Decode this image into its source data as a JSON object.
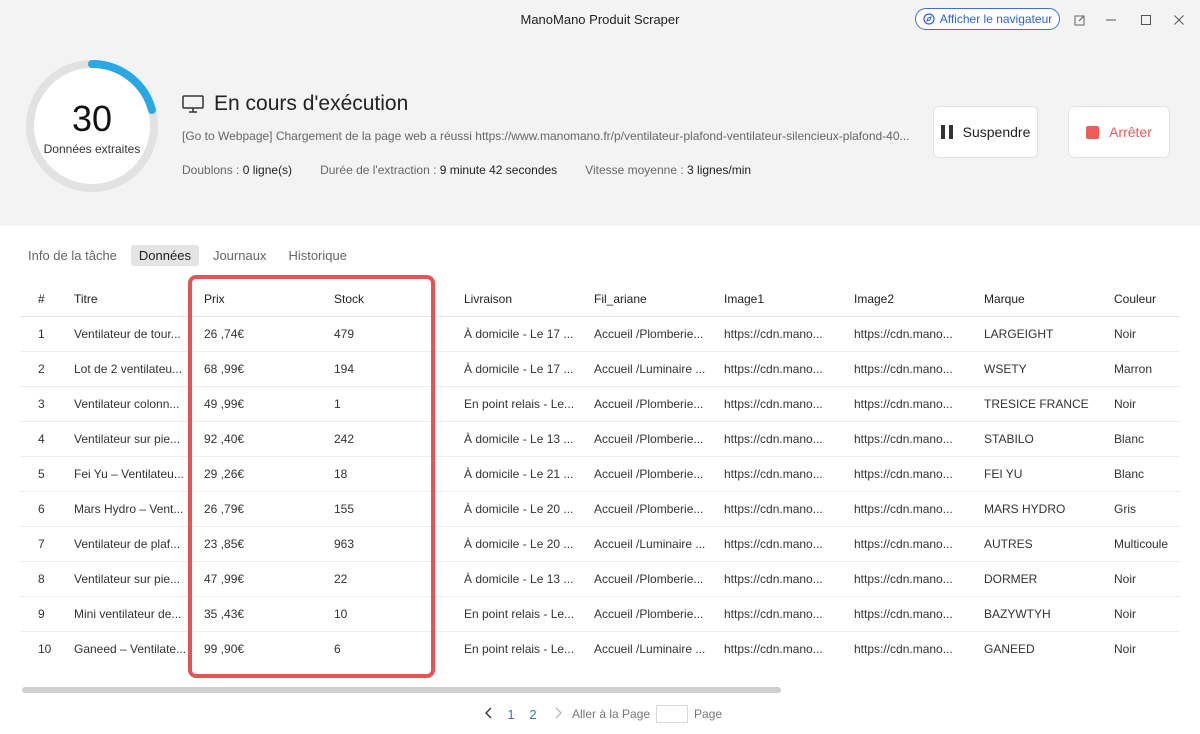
{
  "app": {
    "title": "ManoMano Produit Scraper",
    "browser_button": "Afficher le navigateur"
  },
  "progress": {
    "count": "30",
    "label": "Données extraites"
  },
  "status": {
    "title": "En cours d'exécution",
    "message": "[Go to Webpage] Chargement de la page web a réussi https://www.manomano.fr/p/ventilateur-plafond-ventilateur-silencieux-plafond-40...",
    "duplicates_label": "Doublons : ",
    "duplicates_value": "0 ligne(s)",
    "duration_label": "Durée de l'extraction : ",
    "duration_value": "9 minute 42 secondes",
    "speed_label": "Vitesse moyenne : ",
    "speed_value": "3 lignes/min"
  },
  "actions": {
    "pause": "Suspendre",
    "stop": "Arrêter"
  },
  "tabs": [
    {
      "label": "Info de la tâche"
    },
    {
      "label": "Données",
      "active": true
    },
    {
      "label": "Journaux"
    },
    {
      "label": "Historique"
    }
  ],
  "table": {
    "headers": [
      "#",
      "Titre",
      "Prix",
      "Stock",
      "Livraison",
      "Fil_ariane",
      "Image1",
      "Image2",
      "Marque",
      "Couleur"
    ],
    "rows": [
      [
        "1",
        "Ventilateur de tour...",
        "26 ,74€",
        "479",
        "À domicile - Le 17 ...",
        "Accueil /Plomberie...",
        "https://cdn.mano...",
        "https://cdn.mano...",
        "LARGEIGHT",
        "Noir"
      ],
      [
        "2",
        "Lot de 2 ventilateu...",
        "68 ,99€",
        "194",
        "À domicile - Le 17 ...",
        "Accueil /Luminaire ...",
        "https://cdn.mano...",
        "https://cdn.mano...",
        "WSETY",
        "Marron"
      ],
      [
        "3",
        "Ventilateur colonn...",
        "49 ,99€",
        "1",
        "En point relais - Le...",
        "Accueil /Plomberie...",
        "https://cdn.mano...",
        "https://cdn.mano...",
        "TRESICE FRANCE",
        "Noir"
      ],
      [
        "4",
        "Ventilateur sur pie...",
        "92 ,40€",
        "242",
        "À domicile - Le 13 ...",
        "Accueil /Plomberie...",
        "https://cdn.mano...",
        "https://cdn.mano...",
        "STABILO",
        "Blanc"
      ],
      [
        "5",
        "Fei Yu – Ventilateu...",
        "29 ,26€",
        "18",
        "À domicile - Le 21 ...",
        "Accueil /Plomberie...",
        "https://cdn.mano...",
        "https://cdn.mano...",
        "FEI YU",
        "Blanc"
      ],
      [
        "6",
        "Mars Hydro – Vent...",
        "26 ,79€",
        "155",
        "À domicile - Le 20 ...",
        "Accueil /Plomberie...",
        "https://cdn.mano...",
        "https://cdn.mano...",
        "MARS HYDRO",
        "Gris"
      ],
      [
        "7",
        "Ventilateur de plaf...",
        "23 ,85€",
        "963",
        "À domicile - Le 20 ...",
        "Accueil /Luminaire ...",
        "https://cdn.mano...",
        "https://cdn.mano...",
        "AUTRES",
        "Multicoule"
      ],
      [
        "8",
        "Ventilateur sur pie...",
        "47 ,99€",
        "22",
        "À domicile - Le 13 ...",
        "Accueil /Plomberie...",
        "https://cdn.mano...",
        "https://cdn.mano...",
        "DORMER",
        "Noir"
      ],
      [
        "9",
        "Mini ventilateur de...",
        "35 ,43€",
        "10",
        "En point relais - Le...",
        "Accueil /Plomberie...",
        "https://cdn.mano...",
        "https://cdn.mano...",
        "BAZYWTYH",
        "Noir"
      ],
      [
        "10",
        "Ganeed – Ventilate...",
        "99 ,90€",
        "6",
        "En point relais - Le...",
        "Accueil /Luminaire ...",
        "https://cdn.mano...",
        "https://cdn.mano...",
        "GANEED",
        "Noir"
      ]
    ]
  },
  "pagination": {
    "pages": [
      "1",
      "2"
    ],
    "goto_label": "Aller à la Page",
    "page_suffix": "Page"
  },
  "colors": {
    "accent": "#3b6fd6",
    "stop": "#ee5b5b",
    "highlight": "#e35555",
    "ring": "#29a8e6"
  }
}
